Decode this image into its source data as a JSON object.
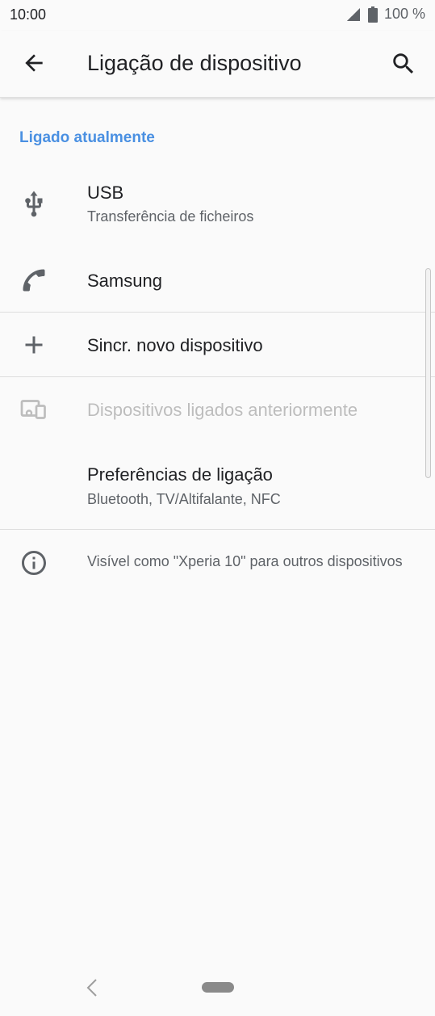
{
  "status_bar": {
    "time": "10:00",
    "battery_text": "100 %"
  },
  "app_bar": {
    "title": "Ligação de dispositivo"
  },
  "section": {
    "header": "Ligado atualmente"
  },
  "items": [
    {
      "icon": "usb-icon",
      "title": "USB",
      "subtitle": "Transferência de ficheiros"
    },
    {
      "icon": "phone-icon",
      "title": "Samsung"
    },
    {
      "icon": "plus-icon",
      "title": "Sincr. novo dispositivo"
    },
    {
      "icon": "devices-icon",
      "title": "Dispositivos ligados anteriormente",
      "disabled": true
    },
    {
      "title": "Preferências de ligação",
      "subtitle": "Bluetooth, TV/Altifalante, NFC"
    }
  ],
  "info": {
    "icon": "info-icon",
    "text": "Visível como \"Xperia 10\" para outros dispositivos"
  },
  "colors": {
    "accent": "#4a90e2",
    "background": "#fafafa",
    "text_primary": "#202124",
    "text_secondary": "#5f6368",
    "text_disabled": "#bdbdbd"
  }
}
